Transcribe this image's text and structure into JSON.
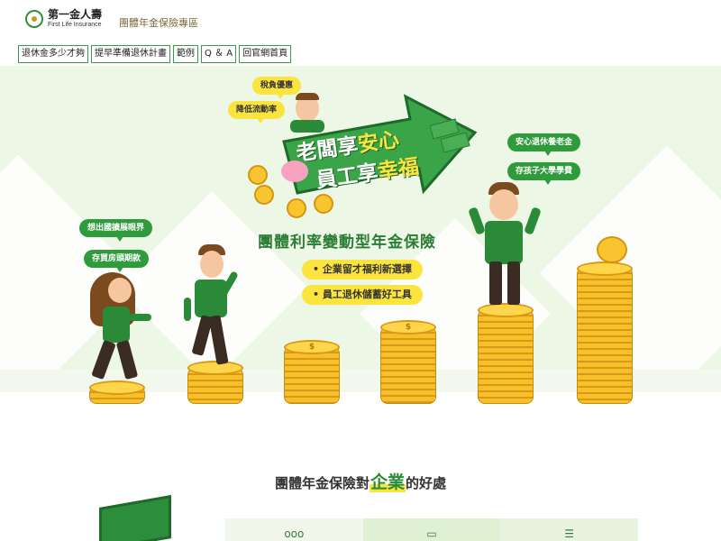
{
  "header": {
    "logo_cn": "第一金人壽",
    "logo_en": "First Life Insurance",
    "site_title": "團體年金保險專區"
  },
  "nav": {
    "items": [
      {
        "label": "退休金多少才夠"
      },
      {
        "label": "提早準備退休計畫"
      },
      {
        "label": "範例"
      },
      {
        "label": "Q ＆ A"
      },
      {
        "label": "回官網首頁"
      }
    ]
  },
  "hero": {
    "bubbles_left_top": [
      "稅負優惠",
      "降低流動率"
    ],
    "bubbles_left": [
      "想出國擴展眼界",
      "存買房頭期款"
    ],
    "bubbles_right": [
      "安心退休養老金",
      "存孩子大學學費"
    ],
    "slogan_line1_part1": "老闆享",
    "slogan_line1_part2": "安心",
    "slogan_line2_part1": "員工享",
    "slogan_line2_part2": "幸福",
    "product_title": "團體利率變動型年金保險",
    "features": [
      "• 企業留才福利新選擇",
      "• 員工退休儲蓄好工具"
    ],
    "coin_symbol": "$"
  },
  "benefits": {
    "title_prefix": "團體年金保險對",
    "title_emphasis": "企業",
    "title_suffix": "的好處",
    "icons": [
      "people-icon",
      "wallet-icon",
      "document-icon"
    ]
  },
  "colors": {
    "brand_green": "#2f9b3c",
    "highlight_yellow": "#fbe43e",
    "hero_bg": "#edf7e6"
  }
}
